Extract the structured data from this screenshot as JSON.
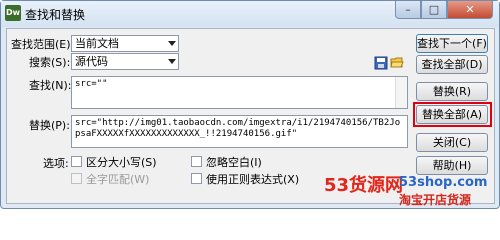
{
  "window": {
    "app_icon_text": "Dw",
    "title": "查找和替换",
    "minimize": "–",
    "maximize": "□",
    "close": "✕"
  },
  "form": {
    "scope_label": "查找范围(E):",
    "scope_value": "当前文档",
    "search_label": "搜索(S):",
    "search_value": "源代码",
    "find_label": "查找(N):",
    "find_value": "src=\"\"",
    "replace_label": "替换(P):",
    "replace_value": "src=\"http://img01.taobaocdn.com/imgextra/i1/2194740156/TB2JopsaFXXXXXfXXXXXXXXXXXXX_!!2194740156.gif\"",
    "options_label": "选项:",
    "options": {
      "match_case": "区分大小写(S)",
      "whole_word": "全字匹配(W)",
      "ignore_whitespace": "忽略空白(I)",
      "use_regex": "使用正则表达式(X)"
    }
  },
  "buttons": {
    "find_next": "查找下一个(F)",
    "find_all": "查找全部(D)",
    "replace": "替换(R)",
    "replace_all": "替换全部(A)",
    "close": "关闭(C)",
    "help": "帮助(H)"
  },
  "watermark": {
    "brand": "53货源网",
    "domain": "53shop.com",
    "tagline": "淘宝开店货源"
  },
  "colors": {
    "highlight_box": "#e0000f"
  },
  "icons": {
    "save": "save-icon",
    "open": "open-folder-icon"
  }
}
